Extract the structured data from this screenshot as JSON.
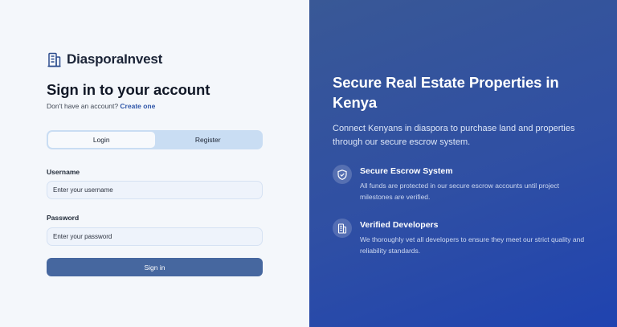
{
  "brand": {
    "name": "DiasporaInvest",
    "icon": "building-icon"
  },
  "form": {
    "title": "Sign in to your account",
    "subtitle_prefix": "Don't have an account?",
    "subtitle_link": "Create one",
    "tabs": [
      {
        "label": "Login",
        "active": true
      },
      {
        "label": "Register",
        "active": false
      }
    ],
    "username": {
      "label": "Username",
      "placeholder": "Enter your username",
      "value": ""
    },
    "password": {
      "label": "Password",
      "placeholder": "Enter your password",
      "value": ""
    },
    "submit_label": "Sign in"
  },
  "hero": {
    "title": "Secure Real Estate Properties in Kenya",
    "description": "Connect Kenyans in diaspora to purchase land and properties through our secure escrow system.",
    "features": [
      {
        "icon": "shield-check-icon",
        "title": "Secure Escrow System",
        "text": "All funds are protected in our secure escrow accounts until project milestones are verified."
      },
      {
        "icon": "building-icon",
        "title": "Verified Developers",
        "text": "We thoroughly vet all developers to ensure they meet our strict quality and reliability standards."
      }
    ]
  },
  "colors": {
    "primary_button": "#46679f",
    "link": "#2e55a8",
    "tab_track": "#c9ddf3",
    "hero_gradient_start": "#395896",
    "hero_gradient_end": "#1f43b0"
  }
}
